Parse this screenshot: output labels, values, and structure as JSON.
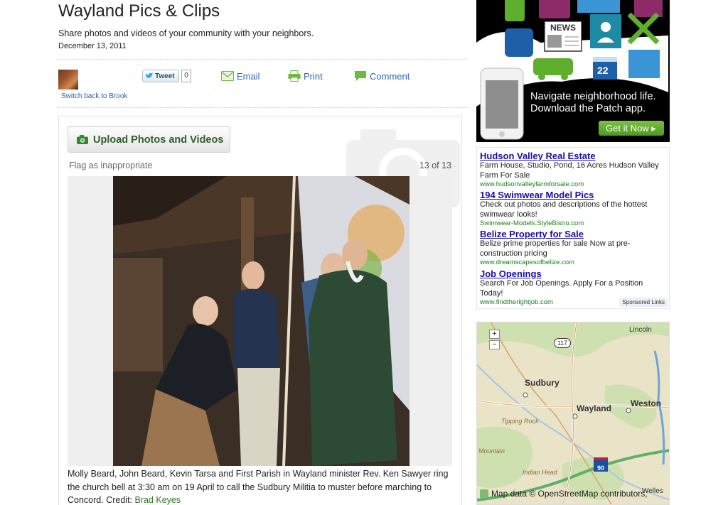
{
  "header": {
    "title": "Wayland Pics & Clips",
    "subtitle": "Share photos and videos of your community with your neighbors.",
    "date": "December 13, 2011"
  },
  "user": {
    "switch_link": "Switch back to Brook"
  },
  "share": {
    "tweet_label": "Tweet",
    "tweet_count": "0",
    "email_label": "Email",
    "print_label": "Print",
    "comment_label": "Comment"
  },
  "gallery": {
    "upload_label": "Upload Photos and Videos",
    "flag_label": "Flag as inappropriate",
    "counter": "13 of 13",
    "caption": "Molly Beard, John Beard, Kevin Tarsa and First Parish in Wayland minister Rev. Ken Sawyer ring the church bell at 3:30 am on 19 April to call the Sudbury Militia to muster before marching to Concord. Credit: ",
    "credit_name": "Brad Keyes"
  },
  "patch_ad": {
    "news_label": "NEWS",
    "calendar_number": "22",
    "line1": "Navigate neighborhood life.",
    "line2": "Download the Patch app.",
    "button": "Get it Now ▸"
  },
  "ads": {
    "items": [
      {
        "title": "Hudson Valley Real Estate",
        "desc": "Farm House, Studio, Pond, 16 Acres Hudson Valley Farm For Sale",
        "url": "www.hudsonvalleyfarmforsale.com"
      },
      {
        "title": "194 Swimwear Model Pics",
        "desc": "Check out photos and descriptions of the hottest swimwear looks!",
        "url": "Swimwear-Models.StyleBistro.com"
      },
      {
        "title": "Belize Property for Sale",
        "desc": "Belize prime properties for sale Now at pre-construction pricing",
        "url": "www.dreamscapesofbelize.com"
      },
      {
        "title": "Job Openings",
        "desc": "Search For Job Openings. Apply For a Position Today!",
        "url": "www.findtherightjob.com"
      }
    ],
    "sponsored_label": "Sponsored Links"
  },
  "map": {
    "zoom_in": "+",
    "zoom_out": "−",
    "route_117": "117",
    "route_90": "90",
    "labels": {
      "lincoln": "Lincoln",
      "sudbury": "Sudbury",
      "wayland": "Wayland",
      "weston": "Weston",
      "tipping_rock": "Tipping Rock",
      "indian_head": "Indian Head",
      "mountain": "Mountain",
      "welles": "Welles"
    },
    "attribution": "Map data © OpenStreetMap contributors,"
  },
  "colors": {
    "link_blue": "#2a6ab8",
    "ad_title_blue": "#1a0dab",
    "ad_url_green": "#1b7c1b",
    "patch_green": "#5fae2e",
    "credit_green": "#2d7a1f"
  },
  "icons": [
    "tweet-bird-icon",
    "email-icon",
    "print-icon",
    "comment-icon",
    "camera-icon",
    "zoom-in-icon",
    "zoom-out-icon"
  ]
}
